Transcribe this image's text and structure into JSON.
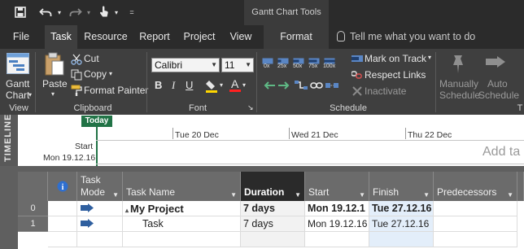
{
  "title_bar": {
    "context_group_title": "Gantt Chart Tools",
    "qat_icons": [
      "save-icon",
      "undo-icon",
      "redo-icon",
      "touch-mode-icon",
      "customize-qat-icon"
    ]
  },
  "tabs": {
    "file": "File",
    "task": "Task",
    "resource": "Resource",
    "report": "Report",
    "project": "Project",
    "view": "View",
    "format": "Format",
    "active": "Task"
  },
  "tell_me": {
    "placeholder": "Tell me what you want to do"
  },
  "ribbon": {
    "view_group": {
      "label": "View",
      "gantt_chart_line1": "Gantt",
      "gantt_chart_line2": "Chart"
    },
    "clipboard_group": {
      "label": "Clipboard",
      "paste": "Paste",
      "cut": "Cut",
      "copy": "Copy",
      "format_painter": "Format Painter"
    },
    "font_group": {
      "label": "Font",
      "font_name": "Calibri",
      "font_size": "11"
    },
    "schedule_group": {
      "label": "Schedule",
      "percent_buttons": [
        "0x",
        "25x",
        "50x",
        "75x",
        "100x"
      ],
      "mark_on_track": "Mark on Track",
      "respect_links": "Respect Links",
      "inactivate": "Inactivate"
    },
    "tasks_group": {
      "manually_line1": "Manually",
      "manually_line2": "Schedule",
      "auto_line1": "Auto",
      "auto_line2": "Schedule",
      "label_partial": "T"
    },
    "colors": {
      "accent_green": "#217346",
      "ribbon_bg": "#3f3f3f",
      "titlebar_bg": "#2b2b2b"
    }
  },
  "timeline": {
    "side_label": "TIMELINE",
    "today_label": "Today",
    "dates": [
      "Tue 20 Dec",
      "Wed 21 Dec",
      "Thu 22 Dec"
    ],
    "start_label": "Start",
    "start_date": "Mon 19.12.16",
    "add_tasks_text": "Add ta"
  },
  "sheet": {
    "columns": {
      "info": "i",
      "task_mode_line1": "Task",
      "task_mode_line2": "Mode",
      "task_name": "Task Name",
      "duration": "Duration",
      "start": "Start",
      "finish": "Finish",
      "predecessors": "Predecessors"
    },
    "rows": [
      {
        "id": "0",
        "name": "My Project",
        "duration": "7 days",
        "start": "Mon 19.12.1",
        "finish": "Tue 27.12.16",
        "predecessors": "",
        "summary_toggle": "▴"
      },
      {
        "id": "1",
        "name": "Task",
        "duration": "7 days",
        "start": "Mon 19.12.16",
        "finish": "Tue 27.12.16",
        "predecessors": ""
      }
    ]
  }
}
